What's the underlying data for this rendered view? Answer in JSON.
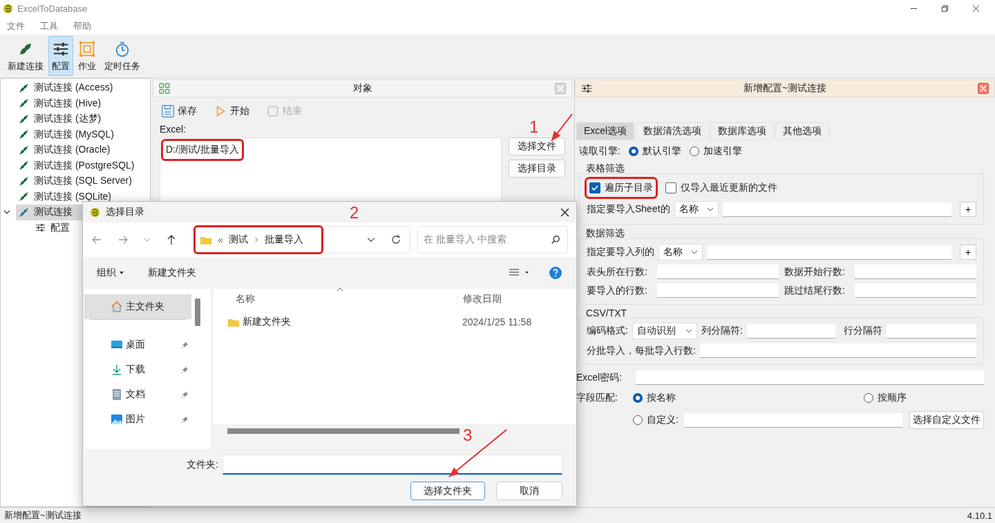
{
  "window": {
    "title": "ExcelToDatabase"
  },
  "menu": [
    "文件",
    "工具",
    "帮助"
  ],
  "toolbar": [
    {
      "label": "新建连接",
      "kind": "connect",
      "selected": false
    },
    {
      "label": "配置",
      "kind": "config",
      "selected": true
    },
    {
      "label": "作业",
      "kind": "job",
      "selected": false
    },
    {
      "label": "定时任务",
      "kind": "timer",
      "selected": false
    }
  ],
  "tree": [
    {
      "label": "测试连接 (Access)",
      "selected": false
    },
    {
      "label": "测试连接 (Hive)",
      "selected": false
    },
    {
      "label": "测试连接 (达梦)",
      "selected": false
    },
    {
      "label": "测试连接 (MySQL)",
      "selected": false
    },
    {
      "label": "测试连接 (Oracle)",
      "selected": false
    },
    {
      "label": "测试连接 (PostgreSQL)",
      "selected": false
    },
    {
      "label": "测试连接 (SQL Server)",
      "selected": false
    },
    {
      "label": "测试连接 (SQLite)",
      "selected": false
    },
    {
      "label": "测试连接",
      "selected": true,
      "expanded": true,
      "children": [
        {
          "label": "配置",
          "selected": false
        }
      ]
    }
  ],
  "object_panel": {
    "title": "对象",
    "actions": [
      {
        "label": "保存",
        "kind": "save",
        "disabled": false
      },
      {
        "label": "开始",
        "kind": "start",
        "disabled": false
      },
      {
        "label": "结束",
        "kind": "stop",
        "disabled": true
      }
    ],
    "excel_label": "Excel:",
    "excel_value": "D:/测试/批量导入",
    "highlighted": true,
    "buttons": [
      "选择文件",
      "选择目录"
    ]
  },
  "config_panel": {
    "title": "新增配置~测试连接",
    "tabs": [
      {
        "label": "Excel选项",
        "selected": true
      },
      {
        "label": "数据清洗选项",
        "selected": false
      },
      {
        "label": "数据库选项",
        "selected": false
      },
      {
        "label": "其他选项",
        "selected": false
      }
    ],
    "engine": {
      "label": "读取引擎:",
      "options": [
        {
          "label": "默认引擎",
          "selected": true
        },
        {
          "label": "加速引擎",
          "selected": false
        }
      ]
    },
    "sheet_filter": {
      "title": "表格筛选",
      "checkboxes": [
        {
          "label": "遍历子目录",
          "checked": true,
          "highlighted": true
        },
        {
          "label": "仅导入最近更新的文件",
          "checked": false,
          "highlighted": false
        }
      ],
      "sheet_label": "指定要导入Sheet的",
      "sheet_mode": "名称",
      "add": "+"
    },
    "data_filter": {
      "title": "数据筛选",
      "column_label": "指定要导入列的",
      "column_mode": "名称",
      "add": "+",
      "fields": [
        "表头所在行数:",
        "数据开始行数:",
        "要导入的行数:",
        "跳过结尾行数:"
      ]
    },
    "csv": {
      "title": "CSV/TXT",
      "encoding_label": "编码格式:",
      "encoding": "自动识别",
      "col_sep": "列分隔符:",
      "row_sep": "行分隔符",
      "batch": "分批导入，每批导入行数:"
    },
    "password_label": "Excel密码:",
    "match": {
      "label": "字段匹配:",
      "options": [
        {
          "label": "按名称",
          "selected": true
        },
        {
          "label": "按顺序",
          "selected": false
        },
        {
          "label": "自定义:",
          "selected": false
        }
      ],
      "custom_button": "选择自定义文件"
    }
  },
  "dialog": {
    "title": "选择目录",
    "breadcrumb_prefix": "«",
    "breadcrumb": [
      "测试",
      "批量导入"
    ],
    "highlighted": true,
    "search_placeholder": "在 批量导入 中搜索",
    "organize": "组织",
    "new_folder": "新建文件夹",
    "nav": [
      {
        "label": "主文件夹",
        "kind": "home",
        "selected": true,
        "pinned": false
      },
      {
        "label": "桌面",
        "kind": "desktop",
        "selected": false,
        "pinned": true
      },
      {
        "label": "下载",
        "kind": "download",
        "selected": false,
        "pinned": true
      },
      {
        "label": "文档",
        "kind": "document",
        "selected": false,
        "pinned": true
      },
      {
        "label": "图片",
        "kind": "image",
        "selected": false,
        "pinned": true
      }
    ],
    "columns": [
      "名称",
      "修改日期"
    ],
    "files": [
      {
        "name": "新建文件夹",
        "modified": "2024/1/25 11:58"
      }
    ],
    "folder_label": "文件夹:",
    "buttons": [
      {
        "label": "选择文件夹",
        "kind": "primary"
      },
      {
        "label": "取消",
        "kind": "secondary"
      }
    ]
  },
  "annotations": [
    {
      "label": "1"
    },
    {
      "label": "2"
    },
    {
      "label": "3"
    }
  ],
  "status_bar": {
    "text": "新增配置~测试连接",
    "version": "4.10.1"
  }
}
